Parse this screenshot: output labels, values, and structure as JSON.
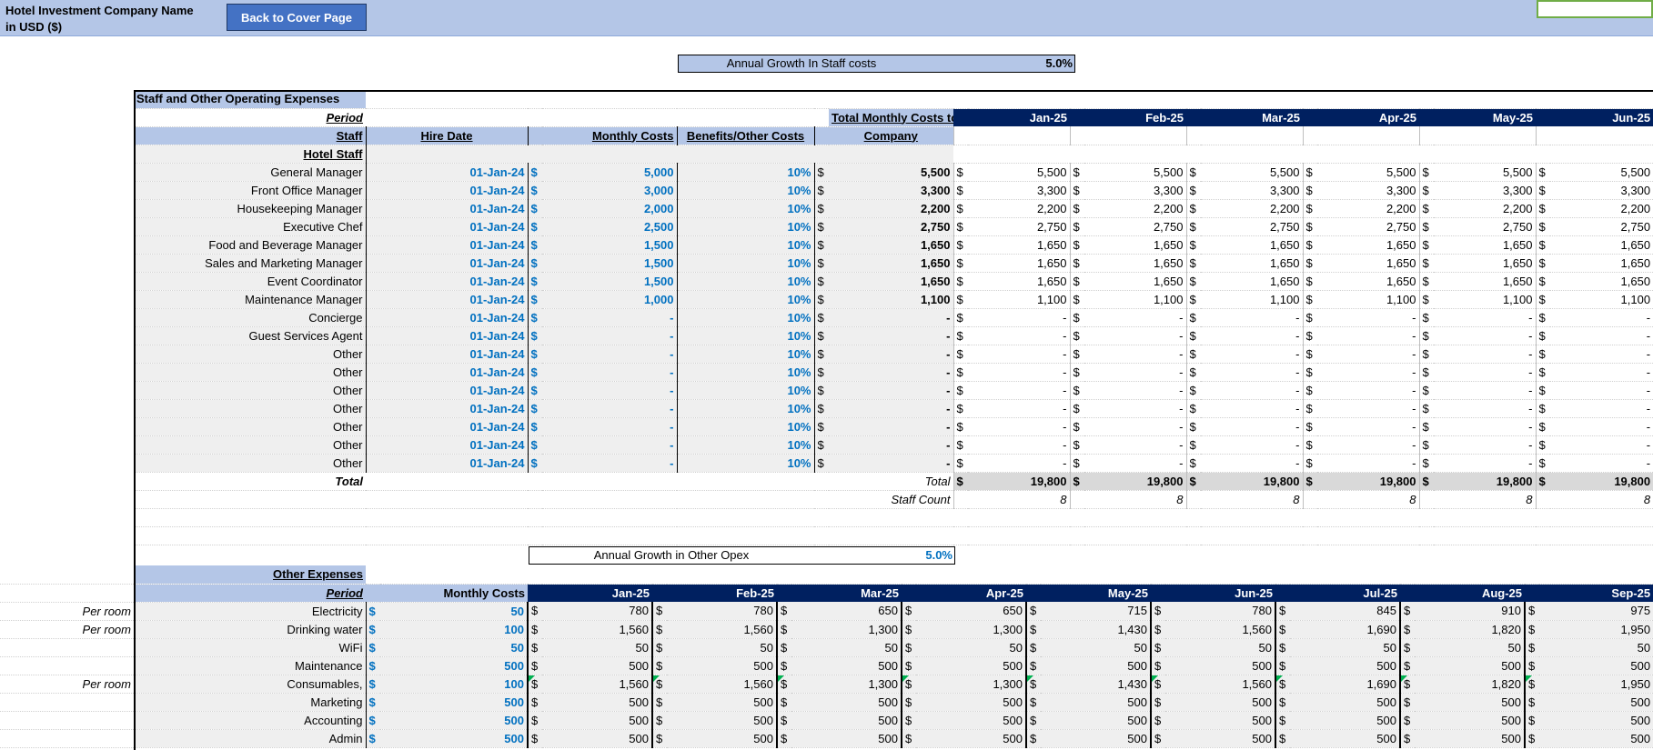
{
  "header": {
    "company_name": "Hotel Investment Company Name",
    "currency": "in USD ($)",
    "back_button_label": "Back to Cover Page"
  },
  "staff_growth": {
    "label": "Annual Growth In Staff costs",
    "value": "5.0%"
  },
  "other_growth": {
    "label": "Annual Growth in Other Opex",
    "value": "5.0%"
  },
  "staff": {
    "section_title": "Staff and Other Operating Expenses",
    "period_label": "Period",
    "col_staff": "Staff",
    "col_hire": "Hire Date",
    "col_monthly": "Monthly Costs",
    "col_benefits": "Benefits/Other Costs",
    "col_total_l1": "Total Monthly Costs to",
    "col_total_l2": "Company",
    "group_label": "Hotel Staff",
    "months": [
      "Jan-25",
      "Feb-25",
      "Mar-25",
      "Apr-25",
      "May-25",
      "Jun-25"
    ],
    "rows": [
      {
        "name": "General Manager",
        "hire": "01-Jan-24",
        "monthly": "5,000",
        "benefit": "10%",
        "total": "5,500",
        "vals": [
          "5,500",
          "5,500",
          "5,500",
          "5,500",
          "5,500",
          "5,500"
        ]
      },
      {
        "name": "Front Office Manager",
        "hire": "01-Jan-24",
        "monthly": "3,000",
        "benefit": "10%",
        "total": "3,300",
        "vals": [
          "3,300",
          "3,300",
          "3,300",
          "3,300",
          "3,300",
          "3,300"
        ]
      },
      {
        "name": "Housekeeping Manager",
        "hire": "01-Jan-24",
        "monthly": "2,000",
        "benefit": "10%",
        "total": "2,200",
        "vals": [
          "2,200",
          "2,200",
          "2,200",
          "2,200",
          "2,200",
          "2,200"
        ]
      },
      {
        "name": "Executive Chef",
        "hire": "01-Jan-24",
        "monthly": "2,500",
        "benefit": "10%",
        "total": "2,750",
        "vals": [
          "2,750",
          "2,750",
          "2,750",
          "2,750",
          "2,750",
          "2,750"
        ]
      },
      {
        "name": "Food and Beverage Manager",
        "hire": "01-Jan-24",
        "monthly": "1,500",
        "benefit": "10%",
        "total": "1,650",
        "vals": [
          "1,650",
          "1,650",
          "1,650",
          "1,650",
          "1,650",
          "1,650"
        ]
      },
      {
        "name": "Sales and Marketing Manager",
        "hire": "01-Jan-24",
        "monthly": "1,500",
        "benefit": "10%",
        "total": "1,650",
        "vals": [
          "1,650",
          "1,650",
          "1,650",
          "1,650",
          "1,650",
          "1,650"
        ]
      },
      {
        "name": "Event Coordinator",
        "hire": "01-Jan-24",
        "monthly": "1,500",
        "benefit": "10%",
        "total": "1,650",
        "vals": [
          "1,650",
          "1,650",
          "1,650",
          "1,650",
          "1,650",
          "1,650"
        ]
      },
      {
        "name": "Maintenance Manager",
        "hire": "01-Jan-24",
        "monthly": "1,000",
        "benefit": "10%",
        "total": "1,100",
        "vals": [
          "1,100",
          "1,100",
          "1,100",
          "1,100",
          "1,100",
          "1,100"
        ]
      },
      {
        "name": "Concierge",
        "hire": "01-Jan-24",
        "monthly": "-",
        "benefit": "10%",
        "total": "-",
        "vals": [
          "-",
          "-",
          "-",
          "-",
          "-",
          "-"
        ]
      },
      {
        "name": "Guest Services Agent",
        "hire": "01-Jan-24",
        "monthly": "-",
        "benefit": "10%",
        "total": "-",
        "vals": [
          "-",
          "-",
          "-",
          "-",
          "-",
          "-"
        ]
      },
      {
        "name": "Other",
        "hire": "01-Jan-24",
        "monthly": "-",
        "benefit": "10%",
        "total": "-",
        "vals": [
          "-",
          "-",
          "-",
          "-",
          "-",
          "-"
        ]
      },
      {
        "name": "Other",
        "hire": "01-Jan-24",
        "monthly": "-",
        "benefit": "10%",
        "total": "-",
        "vals": [
          "-",
          "-",
          "-",
          "-",
          "-",
          "-"
        ]
      },
      {
        "name": "Other",
        "hire": "01-Jan-24",
        "monthly": "-",
        "benefit": "10%",
        "total": "-",
        "vals": [
          "-",
          "-",
          "-",
          "-",
          "-",
          "-"
        ]
      },
      {
        "name": "Other",
        "hire": "01-Jan-24",
        "monthly": "-",
        "benefit": "10%",
        "total": "-",
        "vals": [
          "-",
          "-",
          "-",
          "-",
          "-",
          "-"
        ]
      },
      {
        "name": "Other",
        "hire": "01-Jan-24",
        "monthly": "-",
        "benefit": "10%",
        "total": "-",
        "vals": [
          "-",
          "-",
          "-",
          "-",
          "-",
          "-"
        ]
      },
      {
        "name": "Other",
        "hire": "01-Jan-24",
        "monthly": "-",
        "benefit": "10%",
        "total": "-",
        "vals": [
          "-",
          "-",
          "-",
          "-",
          "-",
          "-"
        ]
      },
      {
        "name": "Other",
        "hire": "01-Jan-24",
        "monthly": "-",
        "benefit": "10%",
        "total": "-",
        "vals": [
          "-",
          "-",
          "-",
          "-",
          "-",
          "-"
        ]
      }
    ],
    "total_label": "Total",
    "total_label2": "Total",
    "totals": [
      "19,800",
      "19,800",
      "19,800",
      "19,800",
      "19,800",
      "19,800"
    ],
    "staff_count_label": "Staff Count",
    "staff_counts": [
      "8",
      "8",
      "8",
      "8",
      "8",
      "8"
    ]
  },
  "other": {
    "section_title": "Other Expenses",
    "period_label": "Period",
    "col_monthly": "Monthly Costs",
    "months": [
      "Jan-25",
      "Feb-25",
      "Mar-25",
      "Apr-25",
      "May-25",
      "Jun-25",
      "Jul-25",
      "Aug-25",
      "Sep-25"
    ],
    "rows": [
      {
        "note": "Per room",
        "name": "Electricity",
        "monthly": "50",
        "flag": false,
        "vals": [
          "780",
          "780",
          "650",
          "650",
          "715",
          "780",
          "845",
          "910",
          "975"
        ]
      },
      {
        "note": "Per room",
        "name": "Drinking water",
        "monthly": "100",
        "flag": false,
        "vals": [
          "1,560",
          "1,560",
          "1,300",
          "1,300",
          "1,430",
          "1,560",
          "1,690",
          "1,820",
          "1,950"
        ]
      },
      {
        "note": "",
        "name": "WiFi",
        "monthly": "50",
        "flag": false,
        "vals": [
          "50",
          "50",
          "50",
          "50",
          "50",
          "50",
          "50",
          "50",
          "50"
        ]
      },
      {
        "note": "",
        "name": "Maintenance",
        "monthly": "500",
        "flag": false,
        "vals": [
          "500",
          "500",
          "500",
          "500",
          "500",
          "500",
          "500",
          "500",
          "500"
        ]
      },
      {
        "note": "Per room",
        "name": "Consumables,",
        "monthly": "100",
        "flag": true,
        "vals": [
          "1,560",
          "1,560",
          "1,300",
          "1,300",
          "1,430",
          "1,560",
          "1,690",
          "1,820",
          "1,950"
        ]
      },
      {
        "note": "",
        "name": "Marketing",
        "monthly": "500",
        "flag": false,
        "vals": [
          "500",
          "500",
          "500",
          "500",
          "500",
          "500",
          "500",
          "500",
          "500"
        ]
      },
      {
        "note": "",
        "name": "Accounting",
        "monthly": "500",
        "flag": false,
        "vals": [
          "500",
          "500",
          "500",
          "500",
          "500",
          "500",
          "500",
          "500",
          "500"
        ]
      },
      {
        "note": "",
        "name": "Admin",
        "monthly": "500",
        "flag": false,
        "vals": [
          "500",
          "500",
          "500",
          "500",
          "500",
          "500",
          "500",
          "500",
          "500"
        ]
      }
    ]
  },
  "dollar_sign": "$"
}
